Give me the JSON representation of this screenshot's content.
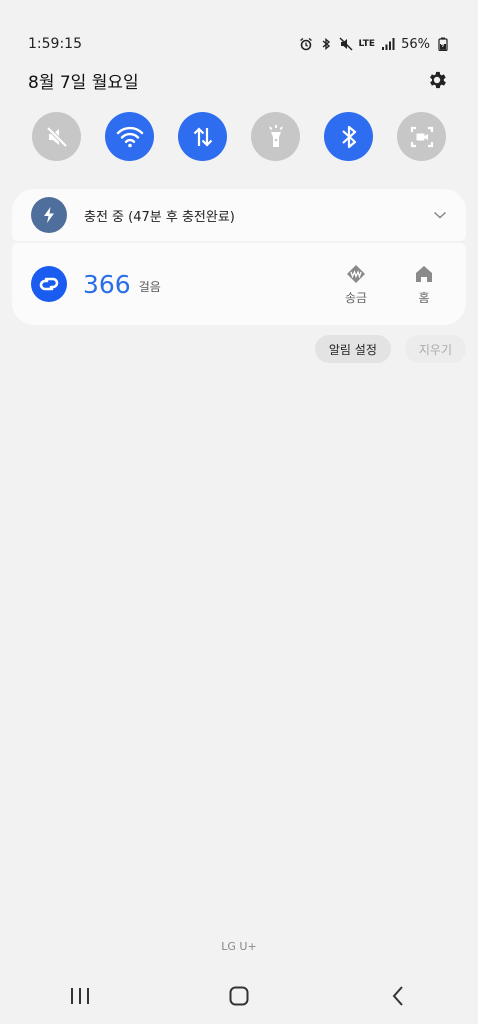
{
  "status_bar": {
    "time": "1:59:15",
    "lte": "LTE",
    "battery_percent": "56%"
  },
  "header": {
    "date": "8월 7일 월요일"
  },
  "quick_settings": [
    {
      "name": "sound",
      "state": "off",
      "icon": "mute-icon"
    },
    {
      "name": "wifi",
      "state": "on",
      "icon": "wifi-icon"
    },
    {
      "name": "mobile-data",
      "state": "on",
      "icon": "data-arrows-icon"
    },
    {
      "name": "flashlight",
      "state": "off",
      "icon": "flashlight-icon"
    },
    {
      "name": "bluetooth",
      "state": "on",
      "icon": "bluetooth-icon"
    },
    {
      "name": "screen-recorder",
      "state": "off",
      "icon": "screen-record-icon"
    }
  ],
  "notifications": {
    "charging": {
      "text": "충전 중 (47분 후 충전완료)"
    },
    "steps": {
      "count": "366",
      "unit": "걸음",
      "action_send": "송금",
      "action_home": "홈"
    },
    "settings_label": "알림 설정",
    "clear_label": "지우기"
  },
  "carrier": "LG U+",
  "colors": {
    "accent": "#2f6df0",
    "tile_off": "#c7c7c7",
    "charging_icon_bg": "#4e6f9c",
    "steps_blue": "#2b6ee8"
  }
}
